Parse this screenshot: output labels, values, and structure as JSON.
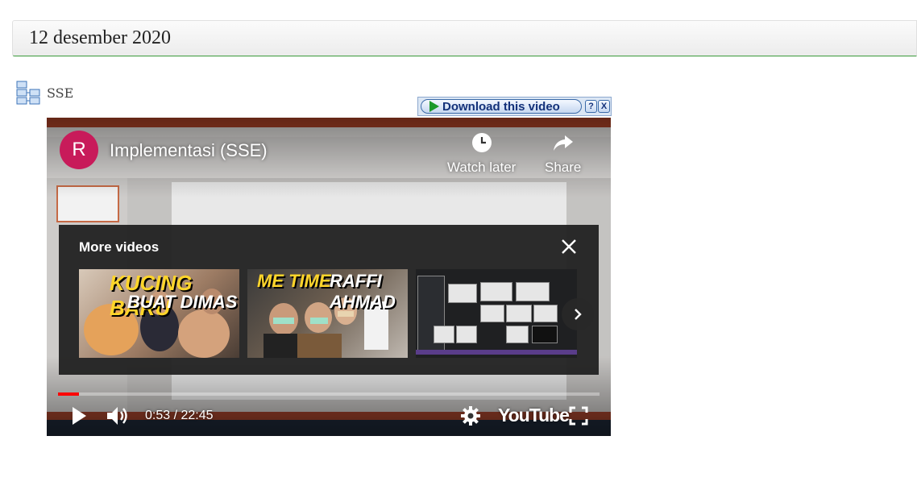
{
  "page": {
    "date_heading": "12 desember 2020"
  },
  "attachment": {
    "label": "SSE",
    "icon": "sitemap-icon"
  },
  "download_bar": {
    "label": "Download this video",
    "help": "?",
    "close": "X"
  },
  "video": {
    "channel_initial": "R",
    "channel_color": "#c81b5a",
    "title": "Implementasi (SSE)",
    "watch_later": "Watch later",
    "share": "Share",
    "more_videos_title": "More videos",
    "suggestions": [
      {
        "line1": "KUCING BARU",
        "line2": "BUAT DIMAS"
      },
      {
        "line1": "ME TIME",
        "line2": "RAFFI AHMAD"
      },
      {
        "line1": "",
        "line2": ""
      }
    ],
    "time_display": "0:53 / 22:45",
    "progress_fraction": 0.039,
    "logo_text": "YouTube"
  }
}
